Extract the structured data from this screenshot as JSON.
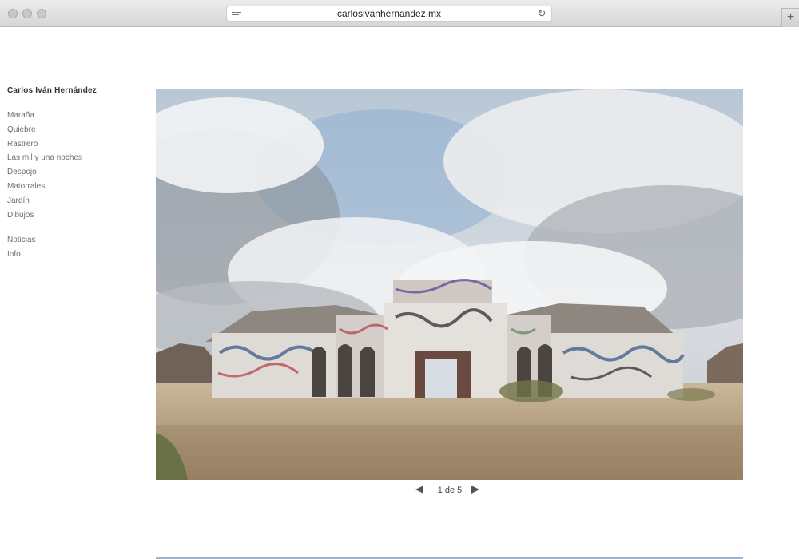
{
  "browser": {
    "url": "carlosivanhernandez.mx",
    "new_tab_label": "+"
  },
  "site": {
    "title": "Carlos Iván Hernández"
  },
  "nav": {
    "projects": [
      {
        "label": "Maraña"
      },
      {
        "label": "Quiebre"
      },
      {
        "label": "Rastrero"
      },
      {
        "label": "Las mil y una noches"
      },
      {
        "label": "Despojo"
      },
      {
        "label": "Matorrales"
      },
      {
        "label": "Jardín"
      },
      {
        "label": "Dibujos"
      }
    ],
    "secondary": [
      {
        "label": "Noticias"
      },
      {
        "label": "Info"
      }
    ]
  },
  "gallery": {
    "pager_text": "1 de 5"
  },
  "colors": {
    "sky": "#c9d3dc",
    "ground": "#b49a78",
    "text": "#6e6e6e"
  }
}
